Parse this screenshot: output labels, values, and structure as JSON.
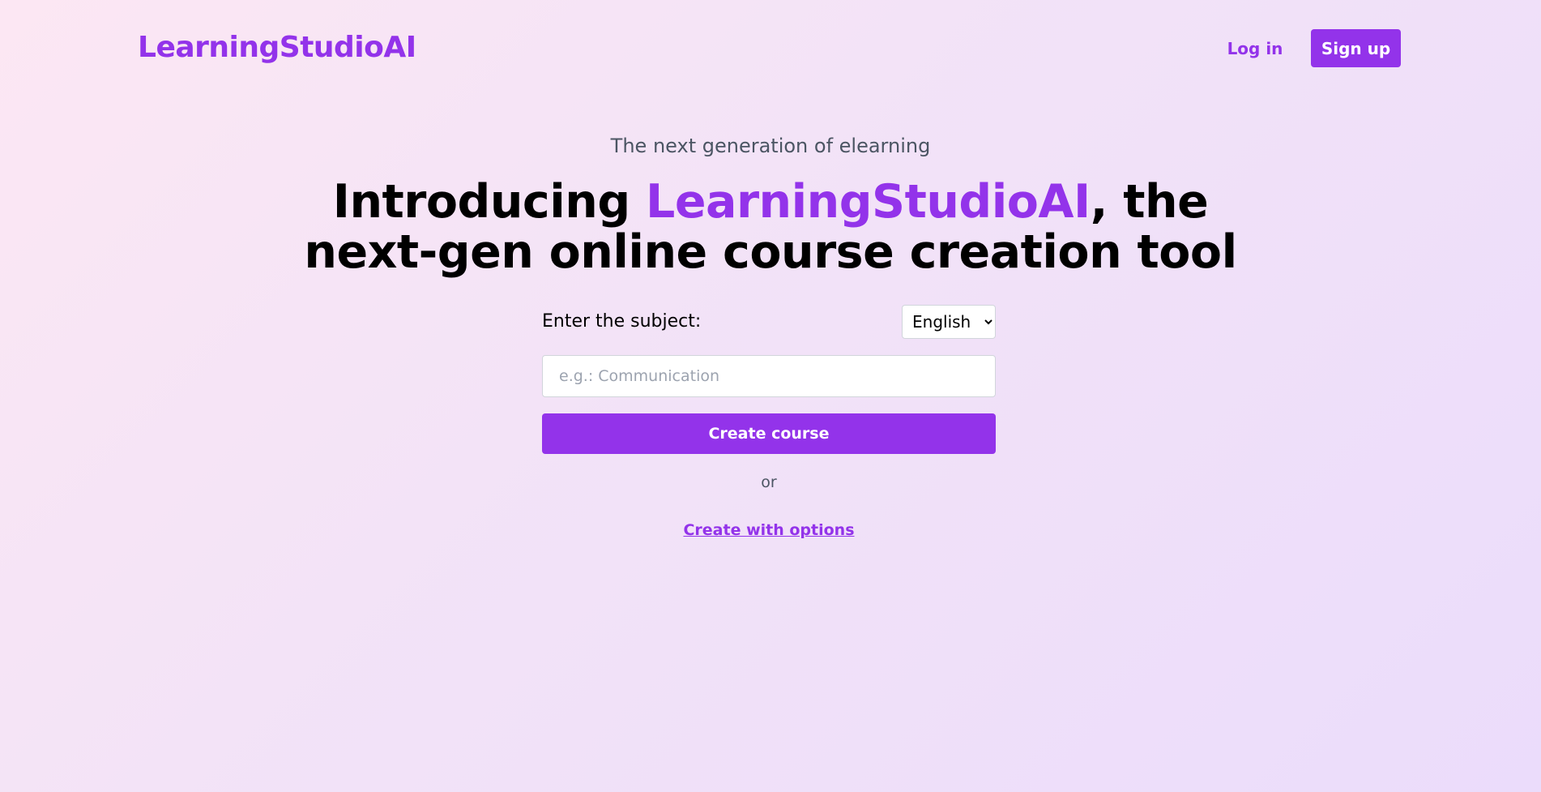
{
  "header": {
    "logo": "LearningStudioAI",
    "login_label": "Log in",
    "signup_label": "Sign up"
  },
  "hero": {
    "tagline": "The next generation of elearning",
    "headline_prefix": "Introducing ",
    "headline_brand": "LearningStudioAI",
    "headline_line1_suffix": ", the",
    "headline_line2": "next-gen online course creation tool"
  },
  "form": {
    "subject_label": "Enter the subject:",
    "language_selected": "English",
    "subject_placeholder": "e.g.: Communication",
    "subject_value": "",
    "create_label": "Create course",
    "or_text": "or",
    "options_link": "Create with options"
  },
  "colors": {
    "accent": "#9333ea",
    "muted_text": "#4b5563"
  }
}
